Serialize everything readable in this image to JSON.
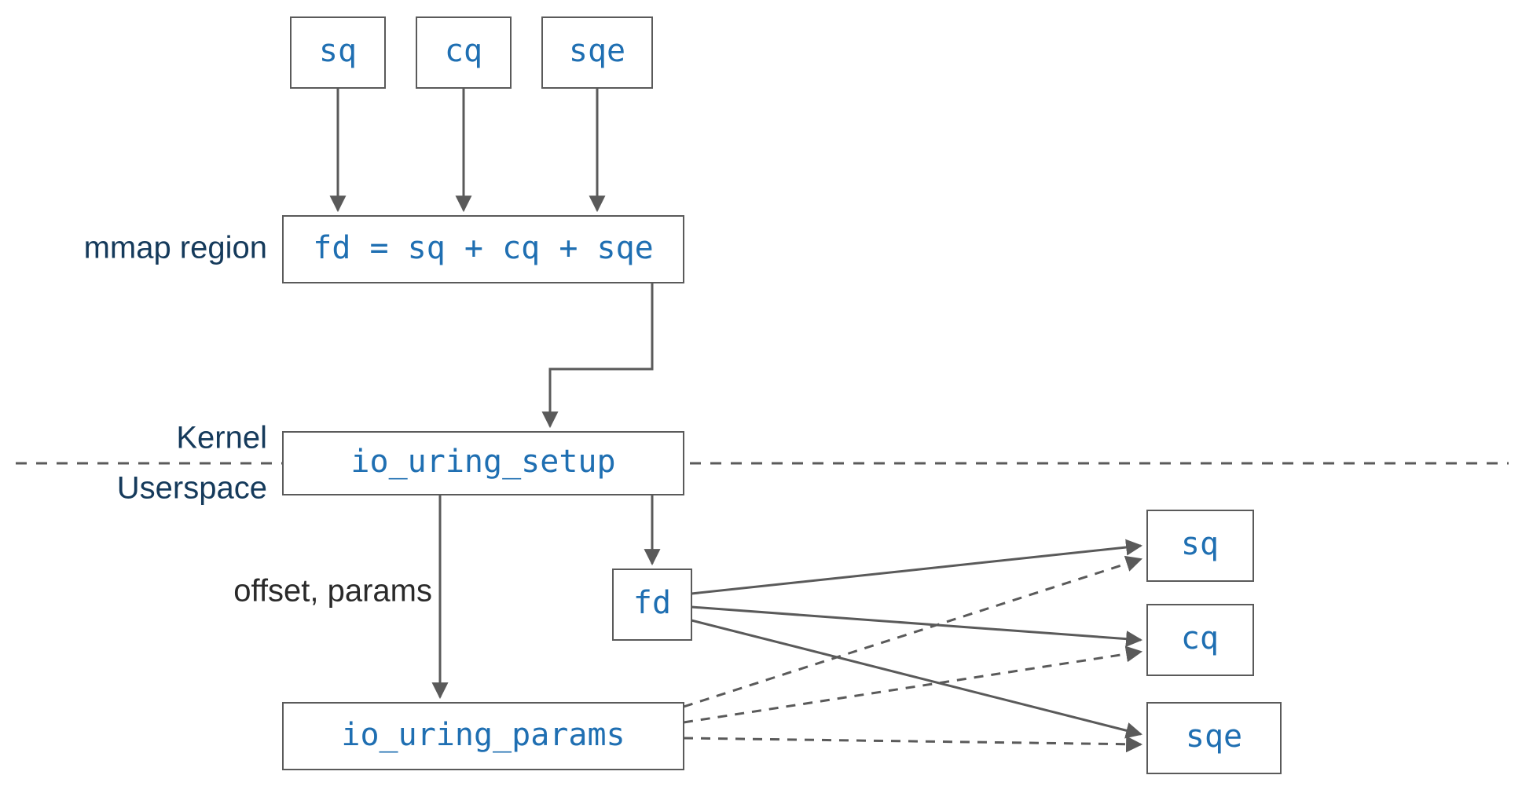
{
  "nodes": {
    "top_sq": "sq",
    "top_cq": "cq",
    "top_sqe": "sqe",
    "mmap_fd": "fd = sq + cq + sqe",
    "setup": "io_uring_setup",
    "fd": "fd",
    "params": "io_uring_params",
    "out_sq": "sq",
    "out_cq": "cq",
    "out_sqe": "sqe"
  },
  "labels": {
    "mmap_region": "mmap region",
    "kernel": "Kernel",
    "userspace": "Userspace",
    "offset": "offset, params"
  },
  "colors": {
    "node_text": "#1f6fb2",
    "label_text": "#153a5b",
    "box_stroke": "#5a5a5a",
    "bg": "#ffffff"
  }
}
